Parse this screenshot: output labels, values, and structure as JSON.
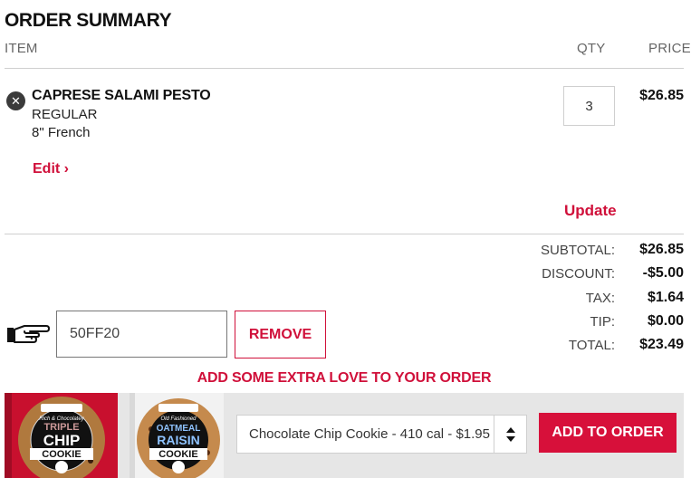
{
  "order": {
    "title": "ORDER SUMMARY",
    "columns": {
      "item": "ITEM",
      "qty": "QTY",
      "price": "PRICE"
    }
  },
  "item": {
    "name": "CAPRESE SALAMI PESTO",
    "size": "REGULAR",
    "bread": "8\" French",
    "edit_label": "Edit ›",
    "qty": "3",
    "price": "$26.85",
    "update_label": "Update"
  },
  "totals": {
    "rows": [
      {
        "label": "SUBTOTAL:",
        "value": "$26.85"
      },
      {
        "label": "DISCOUNT:",
        "value": "-$5.00"
      },
      {
        "label": "TAX:",
        "value": "$1.64"
      },
      {
        "label": "TIP:",
        "value": "$0.00"
      },
      {
        "label": "TOTAL:",
        "value": "$23.49"
      }
    ]
  },
  "promo": {
    "code": "50FF20",
    "remove_label": "REMOVE",
    "icon": "pointing-hand-icon"
  },
  "upsell": {
    "heading": "ADD SOME EXTRA LOVE TO YOUR ORDER",
    "selected_option": "Chocolate Chip Cookie - 410 cal - $1.95",
    "add_label": "ADD TO ORDER",
    "cookies": [
      {
        "top_line": "Rich & Chocolatey",
        "word1": "TRIPLE",
        "word2": "CHIP",
        "word3": "COOKIE"
      },
      {
        "top_line": "Old Fashioned",
        "word1": "OATMEAL",
        "word2": "RAISIN",
        "word3": "COOKIE"
      }
    ]
  },
  "colors": {
    "accent": "#d0103a",
    "text": "#111111",
    "muted": "#666666",
    "band": "#e6e6e6"
  }
}
